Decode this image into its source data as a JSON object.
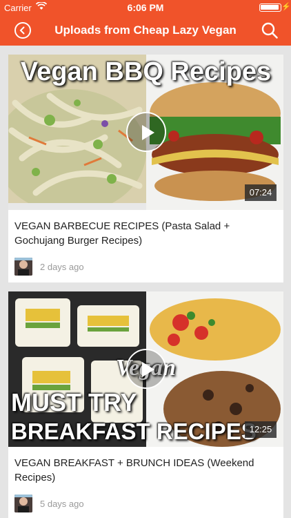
{
  "status_bar": {
    "carrier": "Carrier",
    "time": "6:06 PM"
  },
  "nav": {
    "title": "Uploads from Cheap Lazy Vegan",
    "back_icon": "chevron-left-circle-icon",
    "search_icon": "search-icon"
  },
  "colors": {
    "accent": "#f0532a",
    "background": "#e4e4e4"
  },
  "videos": [
    {
      "thumbnail_text": "Vegan BBQ Recipes",
      "duration": "07:24",
      "title": "VEGAN BARBECUE RECIPES (Pasta Salad + Gochujang Burger Recipes)",
      "age": "2 days ago"
    },
    {
      "thumbnail_text_1": "Vegan",
      "thumbnail_text_2": "MUST TRY",
      "thumbnail_text_3": "BREAKFAST RECIPES",
      "duration": "12:25",
      "title": "VEGAN BREAKFAST + BRUNCH IDEAS (Weekend Recipes)",
      "age": "5 days ago"
    }
  ]
}
